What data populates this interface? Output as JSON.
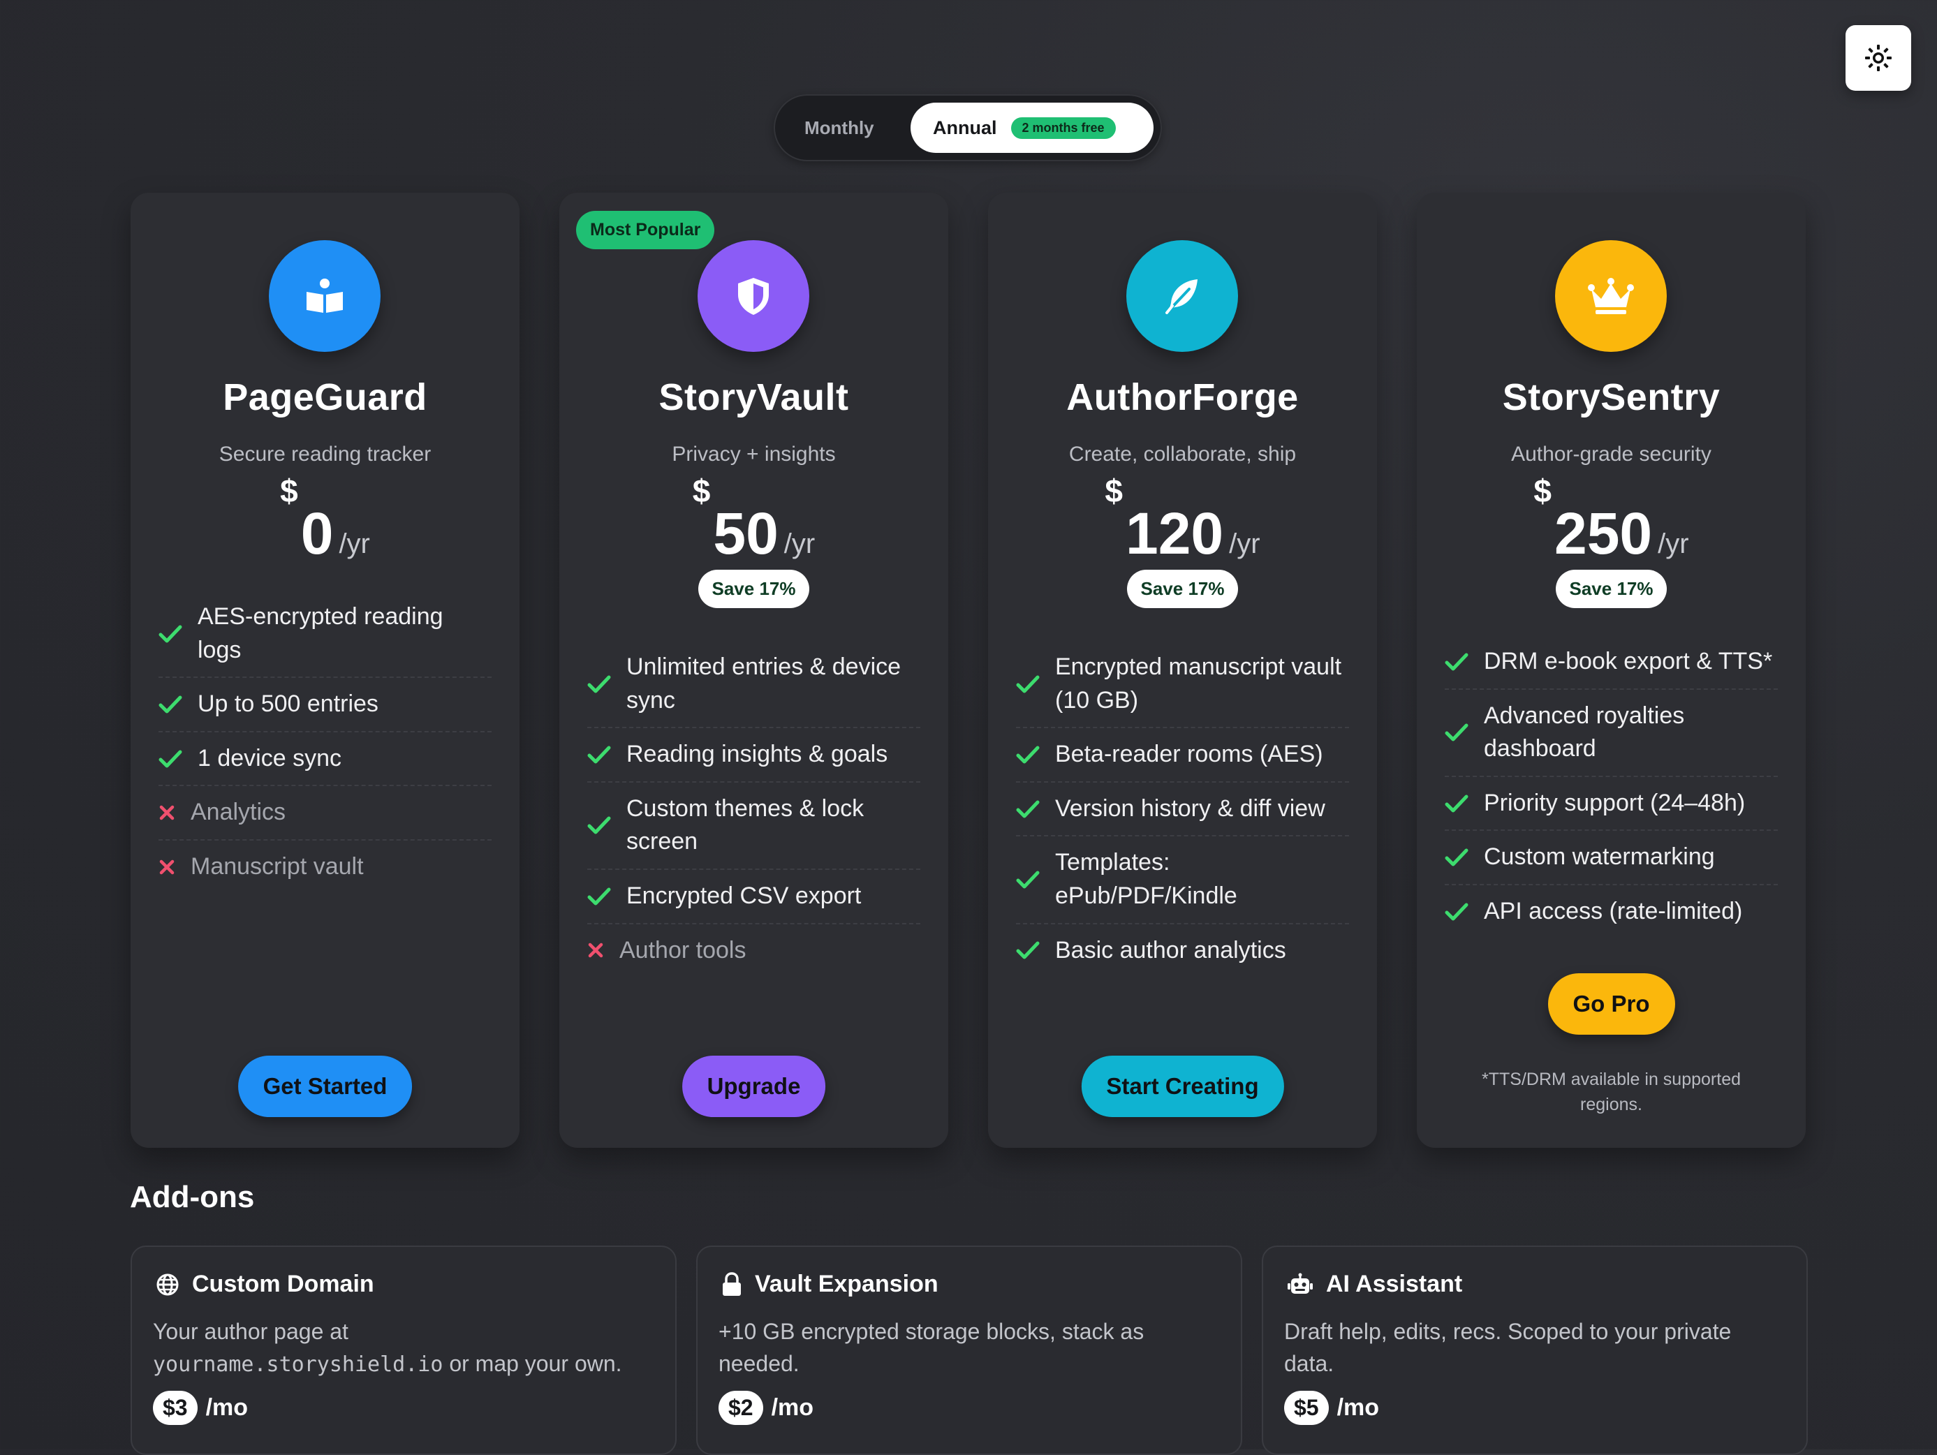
{
  "theme_toggle": {
    "icon": "sun-icon"
  },
  "billing": {
    "monthly_label": "Monthly",
    "annual_label": "Annual",
    "annual_badge": "2 months free",
    "selected": "Annual"
  },
  "plans": [
    {
      "name": "PageGuard",
      "tagline": "Secure reading tracker",
      "currency": "$",
      "price": "0",
      "period": "/yr",
      "icon": "book-reader-icon",
      "accent": "#1f8ff5",
      "features": [
        {
          "text": "AES-encrypted reading logs",
          "included": true
        },
        {
          "text": "Up to 500 entries",
          "included": true
        },
        {
          "text": "1 device sync",
          "included": true
        },
        {
          "text": "Analytics",
          "included": false
        },
        {
          "text": "Manuscript vault",
          "included": false
        }
      ],
      "cta": "Get Started"
    },
    {
      "name": "StoryVault",
      "tagline": "Privacy + insights",
      "currency": "$",
      "price": "50",
      "period": "/yr",
      "save": "Save 17%",
      "badge": "Most Popular",
      "icon": "shield-icon",
      "accent": "#8b5cf6",
      "features": [
        {
          "text": "Unlimited entries & device sync",
          "included": true
        },
        {
          "text": "Reading insights & goals",
          "included": true
        },
        {
          "text": "Custom themes & lock screen",
          "included": true
        },
        {
          "text": "Encrypted CSV export",
          "included": true
        },
        {
          "text": "Author tools",
          "included": false
        }
      ],
      "cta": "Upgrade"
    },
    {
      "name": "AuthorForge",
      "tagline": "Create, collaborate, ship",
      "currency": "$",
      "price": "120",
      "period": "/yr",
      "save": "Save 17%",
      "icon": "feather-icon",
      "accent": "#0fb3d1",
      "features": [
        {
          "text": "Encrypted manuscript vault (10 GB)",
          "included": true
        },
        {
          "text": "Beta-reader rooms (AES)",
          "included": true
        },
        {
          "text": "Version history & diff view",
          "included": true
        },
        {
          "text": "Templates: ePub/PDF/Kindle",
          "included": true
        },
        {
          "text": "Basic author analytics",
          "included": true
        }
      ],
      "cta": "Start Creating"
    },
    {
      "name": "StorySentry",
      "tagline": "Author-grade security",
      "currency": "$",
      "price": "250",
      "period": "/yr",
      "save": "Save 17%",
      "icon": "crown-icon",
      "accent": "#fbb70c",
      "features": [
        {
          "text": "DRM e-book export & TTS*",
          "included": true
        },
        {
          "text": "Advanced royalties dashboard",
          "included": true
        },
        {
          "text": "Priority support (24–48h)",
          "included": true
        },
        {
          "text": "Custom watermarking",
          "included": true
        },
        {
          "text": "API access (rate-limited)",
          "included": true
        }
      ],
      "cta": "Go Pro",
      "footnote": "*TTS/DRM available in supported regions."
    }
  ],
  "addons": {
    "title": "Add-ons",
    "items": [
      {
        "icon": "globe-icon",
        "title": "Custom Domain",
        "desc_prefix": "Your author page at",
        "desc_code": "yourname.storyshield.io",
        "desc_suffix": "or map your own.",
        "price": "$3",
        "period": "/mo"
      },
      {
        "icon": "lock-icon",
        "title": "Vault Expansion",
        "desc": "+10 GB encrypted storage blocks, stack as needed.",
        "price": "$2",
        "period": "/mo"
      },
      {
        "icon": "robot-icon",
        "title": "AI Assistant",
        "desc": "Draft help, edits, recs. Scoped to your private data.",
        "price": "$5",
        "period": "/mo"
      }
    ]
  }
}
